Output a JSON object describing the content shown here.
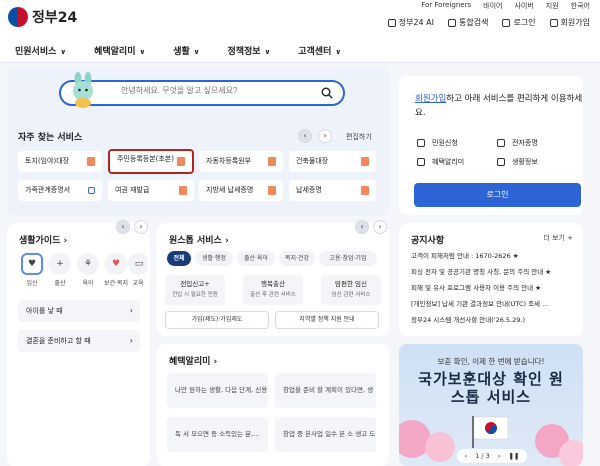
{
  "header": {
    "logo_text": "정부24",
    "util_links": [
      "For Foreigners",
      "바이어",
      "사이버",
      "지원",
      "한국어"
    ],
    "actions": [
      "정부24 AI",
      "통합검색",
      "로그인",
      "회원가입"
    ]
  },
  "nav": [
    "민원서비스",
    "혜택알리미",
    "생활",
    "정책정보",
    "고객센터"
  ],
  "search": {
    "placeholder": "안녕하세요. 무엇을 알고 싶으세요?"
  },
  "frequent": {
    "title": "자주 찾는 서비스",
    "edit_label": "편집하기",
    "items": [
      "토지(임야)대장",
      "주민등록등본(초본)",
      "자동차등록원부",
      "건축물대장",
      "가족관계증명서",
      "여권 재발급",
      "지방세 납세증명",
      "납세증명"
    ]
  },
  "login_card": {
    "title_link": "회원가입",
    "title_rest": "하고 아래 서비스를 편리하게 이용하세요.",
    "items": [
      "민원신청",
      "전자증명",
      "혜택알리미",
      "생활정보"
    ],
    "button": "로그인"
  },
  "life_guide": {
    "title": "생활가이드",
    "categories": [
      "임신",
      "출산",
      "육아",
      "보건·복지",
      "교육"
    ],
    "rows": [
      "아이를 낳 때",
      "결혼을 준비하고 할 때"
    ]
  },
  "one_stop": {
    "title": "원스톱 서비스",
    "pills": [
      "전체",
      "생활·행정",
      "출산·육아",
      "복지·건강",
      "고용·창업·기업"
    ],
    "cards": [
      {
        "title": "전입신고+",
        "sub": "전입 시 필요한 민원"
      },
      {
        "title": "행복출산",
        "sub": "출산 후 관련 서비스"
      },
      {
        "title": "맘편한 임신",
        "sub": "임신 관련 서비스"
      }
    ],
    "links": [
      "가입(제도)·가입제도",
      "지역별 정책 지원 안내"
    ]
  },
  "benefits": {
    "title": "혜택알리미",
    "items": [
      "나만 원하는 생활, 다음 단계, 신용...",
      "창업을 준비 할 계획이 있다면, 생 ...",
      "독 서 모으면 등 소득있는 분,...",
      "창업 중 본사업 일수 본 소 생고 도움,"
    ]
  },
  "notice": {
    "title": "공지사항",
    "more_label": "더 보기",
    "items": [
      "고객이 피해처럼 안내 : 1670-2626 ★",
      "피싱 전자 및 공공기관 명칭 사칭, 문의 주의 안내 ★",
      "피해 및 유사 프로그램 사용자 이용 주의 안내 ★",
      "[개인정보] 납세 기관 결과정보 안내(UTC) 조세 ...",
      "정부24 시스템 개선사항 안내('26.5.29.)"
    ]
  },
  "banner": {
    "subtitle": "보훈 확인, 이제 한 번에 받습니다!",
    "headline": "국가보훈대상 확인 원스톱 서비스",
    "pager": "1 / 3"
  },
  "colors": {
    "accent": "#2d64d6",
    "highlight_border": "#b3261e",
    "navy": "#1a3a7a"
  }
}
